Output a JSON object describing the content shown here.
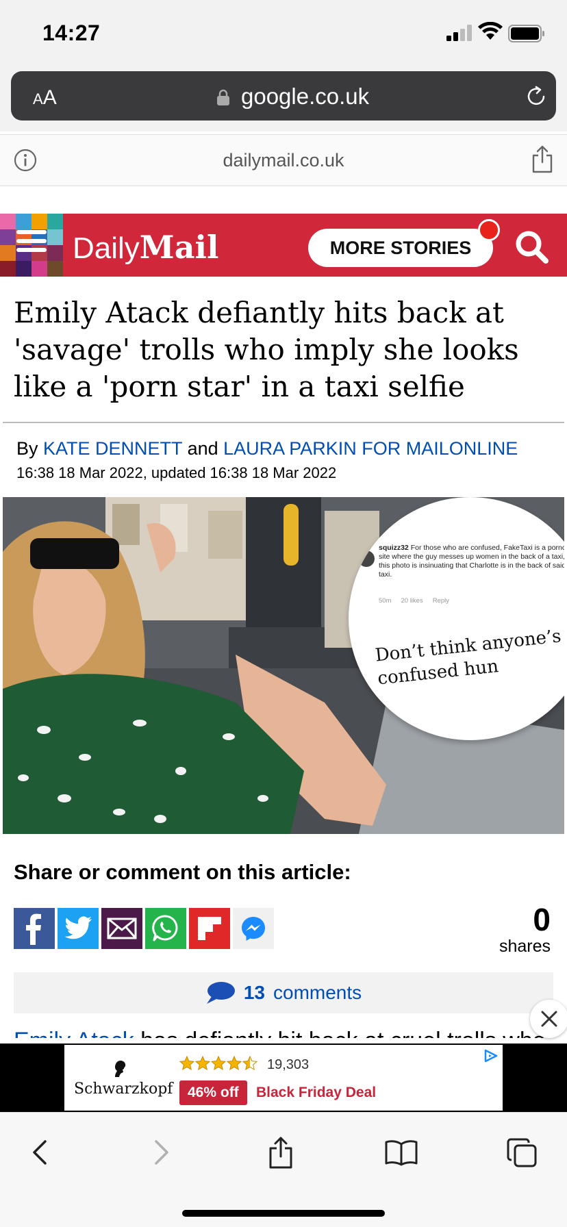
{
  "status_bar": {
    "time": "14:27"
  },
  "browser": {
    "text_size_label_small": "A",
    "text_size_label_large": "A",
    "address": "google.co.uk",
    "page_domain": "dailymail.co.uk"
  },
  "site_header": {
    "logo_daily": "Daily",
    "logo_mail": "Mail",
    "more_stories_label": "MORE STORIES",
    "brand_color": "#d0283a"
  },
  "article": {
    "headline": "Emily Atack defiantly hits back at 'savage' trolls who imply she looks like a 'porn star' in a taxi selfie",
    "byline_prefix": "By",
    "author_1": "KATE DENNETT",
    "byline_join": "and",
    "author_2": "LAURA PARKIN FOR MAILONLINE",
    "dateline": "16:38 18 Mar 2022, updated 16:38 18 Mar 2022",
    "image_inset": {
      "commenter": "squizz32",
      "comment": "For those who are confused, FakeTaxi is a porno site where the guy messes up women in the back of a taxi, so this photo is insinuating that Charlotte is in the back of said taxi.",
      "time": "50m",
      "likes": "20 likes",
      "reply_label": "Reply",
      "caption": "Don’t think anyone’s confused hun"
    },
    "first_paragraph_link": "Emily Atack",
    "first_paragraph_rest": " has defiantly hit back at cruel trolls who"
  },
  "share": {
    "title": "Share or comment on this article:",
    "buttons": [
      {
        "name": "facebook",
        "color": "#3b5998"
      },
      {
        "name": "twitter",
        "color": "#1da1f2"
      },
      {
        "name": "email",
        "color": "#4b1a48"
      },
      {
        "name": "whatsapp",
        "color": "#25b34b"
      },
      {
        "name": "flipboard",
        "color": "#e12828"
      },
      {
        "name": "messenger",
        "color": "#f0f0f0"
      }
    ],
    "count": "0",
    "count_label": "shares"
  },
  "comments": {
    "count": "13",
    "label": "comments"
  },
  "ad": {
    "brand": "Schwarzkopf",
    "rating_count": "19,303",
    "stars": 4.5,
    "discount": "46% off",
    "deal": "Black Friday Deal"
  }
}
